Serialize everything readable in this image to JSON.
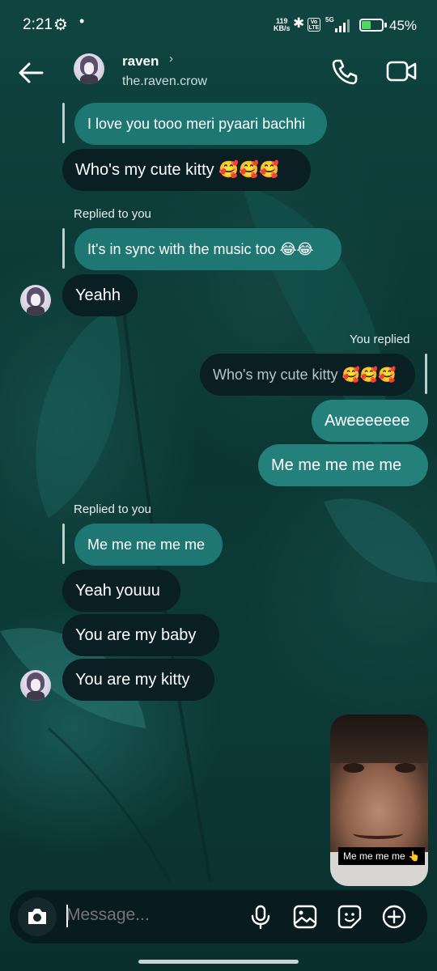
{
  "status_bar": {
    "time": "2:21",
    "speed_top": "119",
    "speed_bottom": "KB/s",
    "volte": "Vo LTE",
    "network": "5G",
    "battery_level": 45,
    "battery_pct": "45%",
    "icons": [
      "settings-icon",
      "bluetooth-icon",
      "signal-icon",
      "battery-icon"
    ]
  },
  "header": {
    "name": "raven",
    "username": "the.raven.crow",
    "icons": [
      "back-arrow-icon",
      "chevron-right-icon",
      "phone-icon",
      "video-icon"
    ]
  },
  "messages": {
    "m1": {
      "text": "I love you tooo meri pyaari bachhi",
      "side": "received",
      "type": "quoted"
    },
    "m2": {
      "text": "Who's my cute kitty 🥰🥰🥰",
      "side": "received"
    },
    "m3_label": "Replied to you",
    "m3_quote": "It's in sync with the music too 😂😂",
    "m4": {
      "text": "Yeahh",
      "side": "received"
    },
    "m5_label": "You replied",
    "m5_quote": "Who's my cute kitty 🥰🥰🥰",
    "m6": {
      "text": "Aweeeeeee",
      "side": "sent"
    },
    "m7": {
      "text": "Me me me me me",
      "side": "sent"
    },
    "m8_label": "Replied to you",
    "m8_quote": "Me me me me me",
    "m9": {
      "text": "Yeah youuu",
      "side": "received"
    },
    "m10": {
      "text": "You are my baby",
      "side": "received"
    },
    "m11": {
      "text": "You are my kitty",
      "side": "received"
    }
  },
  "video_message": {
    "caption": "Me me me me 👆"
  },
  "composer": {
    "placeholder": "Message...",
    "icons": [
      "camera-icon",
      "microphone-icon",
      "gallery-icon",
      "sticker-icon",
      "plus-circle-icon"
    ]
  },
  "colors": {
    "sent_bubble": "#24807b",
    "received_bubble": "#0a1f23",
    "background": "#0d3a38"
  }
}
